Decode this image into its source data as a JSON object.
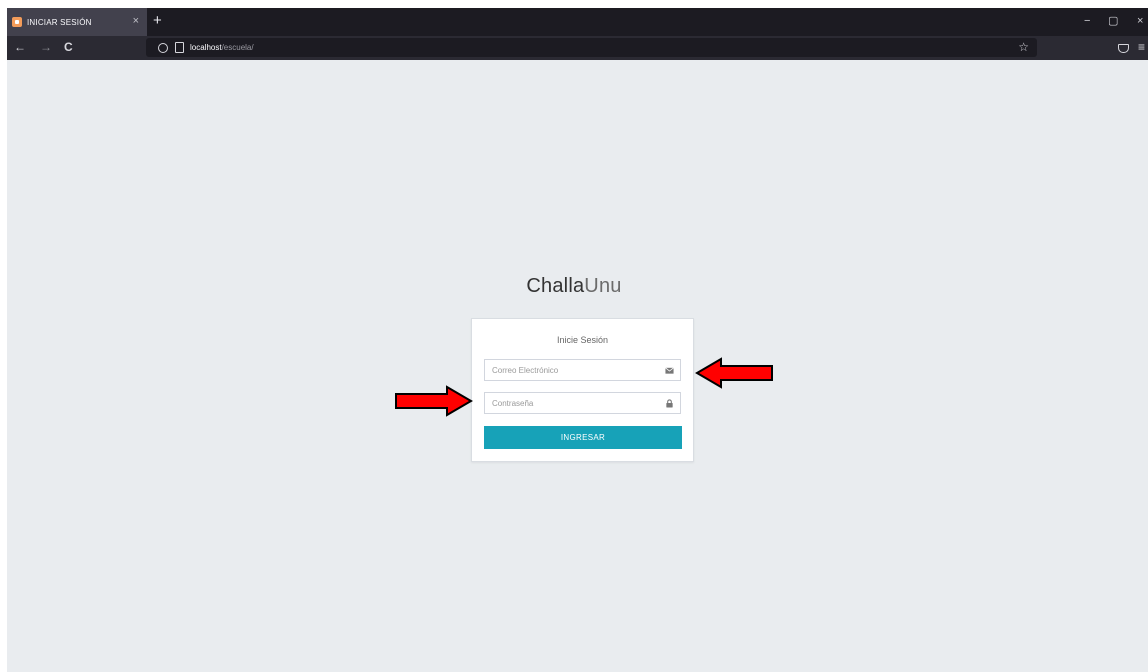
{
  "browser": {
    "tab": {
      "title": "INICIAR SESIÓN",
      "close": "×"
    },
    "new_tab": "+",
    "window": {
      "minimize": "−",
      "restore": "▢",
      "close": "×"
    },
    "nav": {
      "back": "←",
      "forward": "→",
      "reload": "C"
    },
    "url": {
      "host": "localhost",
      "path": "/escuela/"
    },
    "bookmark": "☆",
    "menu": "≡"
  },
  "login": {
    "brand_bold": "Challa",
    "brand_light": "Unu",
    "title": "Inicie Sesión",
    "email": {
      "placeholder": "Correo Electrónico",
      "icon": "envelope-icon"
    },
    "password": {
      "placeholder": "Contraseña",
      "icon": "lock-icon"
    },
    "submit_label": "INGRESAR"
  },
  "annotations": [
    {
      "direction": "left",
      "color": "#ff0000",
      "target": "email"
    },
    {
      "direction": "right",
      "color": "#ff0000",
      "target": "password"
    }
  ],
  "colors": {
    "background": "#e9ecef",
    "button": "#17a2b8",
    "arrow": "#ff0000"
  }
}
